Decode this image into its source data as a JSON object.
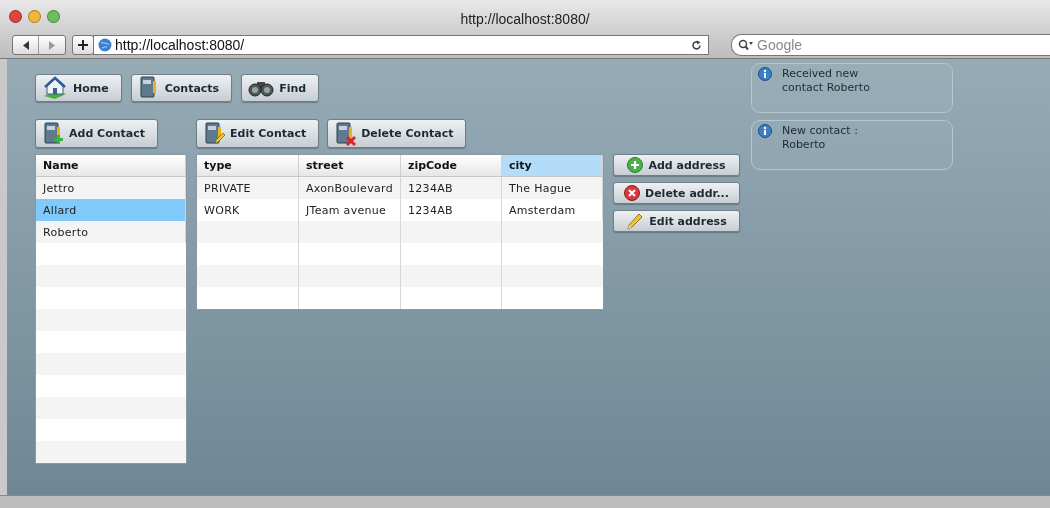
{
  "window": {
    "title": "http://localhost:8080/"
  },
  "toolbar": {
    "address": "http://localhost:8080/",
    "search_placeholder": "Google"
  },
  "nav_buttons": [
    {
      "kind": "home",
      "label": "Home"
    },
    {
      "kind": "contacts",
      "label": "Contacts"
    },
    {
      "kind": "find",
      "label": "Find"
    }
  ],
  "contact_buttons": [
    {
      "kind": "add",
      "label": "Add Contact"
    },
    {
      "kind": "edit",
      "label": "Edit Contact"
    },
    {
      "kind": "delete",
      "label": "Delete Contact"
    }
  ],
  "contacts": {
    "column": "Name",
    "rows": [
      {
        "name": "Jettro",
        "selected": false
      },
      {
        "name": "Allard",
        "selected": true
      },
      {
        "name": "Roberto",
        "selected": false
      }
    ]
  },
  "addresses": {
    "columns": [
      {
        "label": "type",
        "selected": false
      },
      {
        "label": "street",
        "selected": false
      },
      {
        "label": "zipCode",
        "selected": false
      },
      {
        "label": "city",
        "selected": true
      }
    ],
    "rows": [
      [
        "PRIVATE",
        "AxonBoulevard",
        "1234AB",
        "The Hague"
      ],
      [
        "WORK",
        "JTeam avenue",
        "1234AB",
        "Amsterdam"
      ]
    ]
  },
  "address_buttons": [
    {
      "kind": "add",
      "label": "Add address"
    },
    {
      "kind": "delete",
      "label": "Delete addr..."
    },
    {
      "kind": "edit",
      "label": "Edit address"
    }
  ],
  "notifications": [
    "Received new\ncontact Roberto",
    "New contact :\nRoberto"
  ]
}
